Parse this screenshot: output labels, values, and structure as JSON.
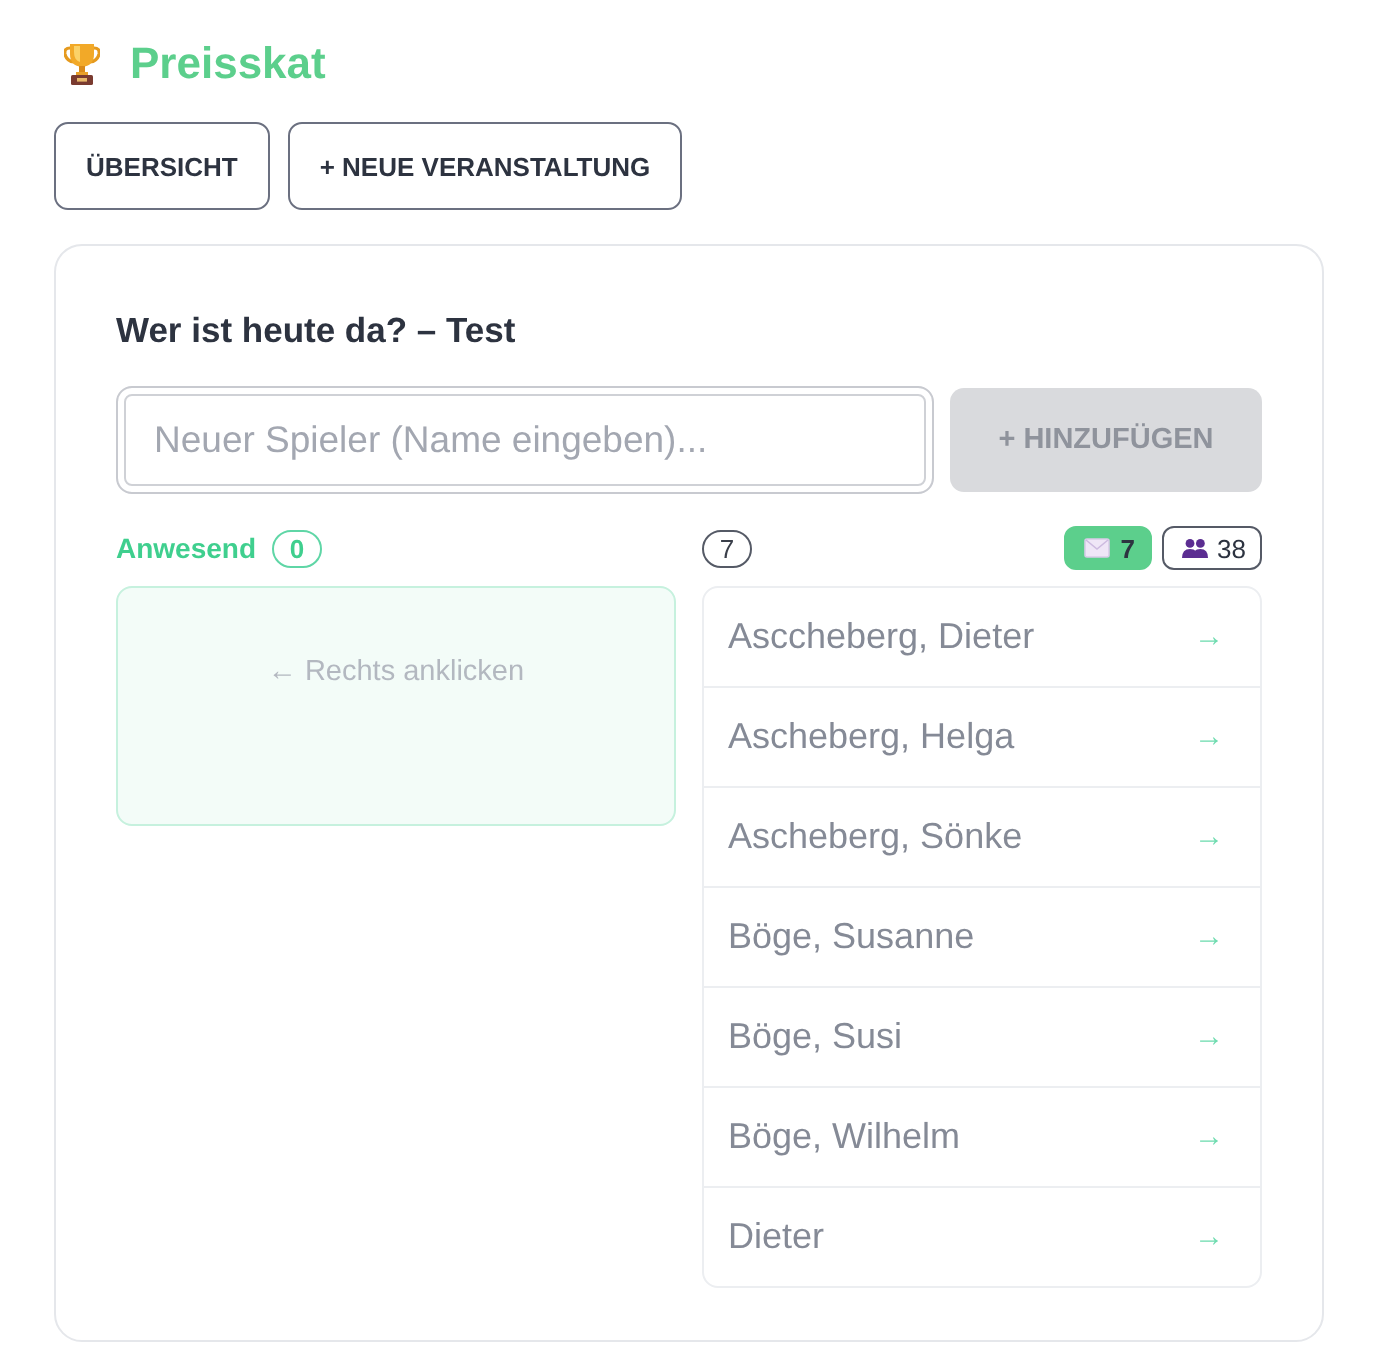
{
  "header": {
    "title": "Preisskat"
  },
  "nav_buttons": [
    {
      "label": "ÜBERSICHT"
    },
    {
      "label": "+ NEUE VERANSTALTUNG"
    }
  ],
  "card": {
    "heading": "Wer ist heute da? – Test",
    "new_player": {
      "placeholder": "Neuer Spieler (Name eingeben)...",
      "focused": true
    },
    "add_button": {
      "label": "+ HINZUFÜGEN",
      "disabled": true
    },
    "present": {
      "label": "Anwesend",
      "count": "0",
      "empty_hint": "← Rechts anklicken"
    },
    "available": {
      "count": "7",
      "filters": [
        {
          "kind": "mail",
          "count": "7",
          "selected": true
        },
        {
          "kind": "group",
          "count": "38",
          "selected": false
        }
      ],
      "players": [
        {
          "name": "Asccheberg, Dieter",
          "arrow": "→"
        },
        {
          "name": "Ascheberg, Helga",
          "arrow": "→"
        },
        {
          "name": "Ascheberg, Sönke",
          "arrow": "→"
        },
        {
          "name": "Böge, Susanne",
          "arrow": "→"
        },
        {
          "name": "Böge, Susi",
          "arrow": "→"
        },
        {
          "name": "Böge, Wilhelm",
          "arrow": "→"
        },
        {
          "name": "Dieter",
          "arrow": "→"
        }
      ]
    }
  }
}
